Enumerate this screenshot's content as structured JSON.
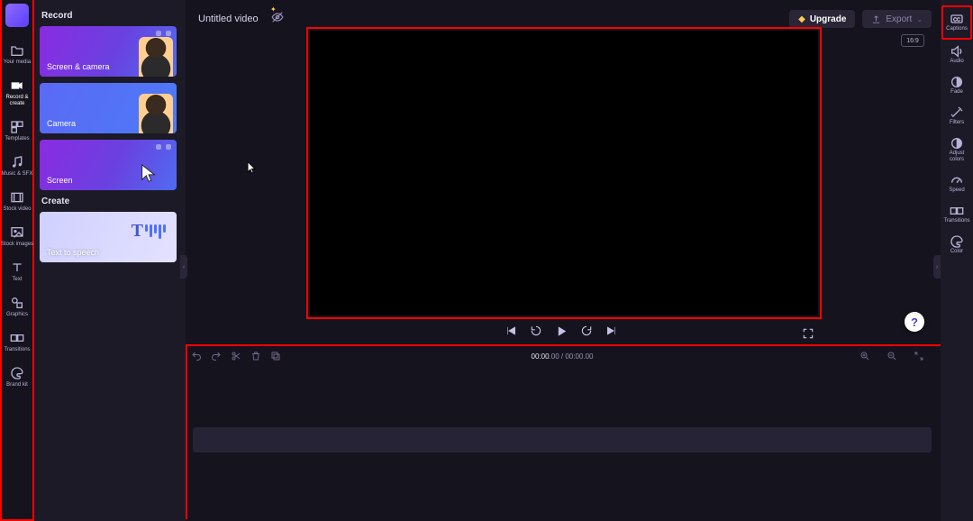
{
  "header": {
    "title": "Untitled video",
    "upgrade_label": "Upgrade",
    "export_label": "Export",
    "aspect_ratio": "16:9"
  },
  "left_rail": [
    {
      "id": "your-media",
      "label": "Your media"
    },
    {
      "id": "record-create",
      "label": "Record & create",
      "active": true
    },
    {
      "id": "templates",
      "label": "Templates"
    },
    {
      "id": "music-sfx",
      "label": "Music & SFX"
    },
    {
      "id": "stock-video",
      "label": "Stock video"
    },
    {
      "id": "stock-images",
      "label": "Stock images"
    },
    {
      "id": "text",
      "label": "Text"
    },
    {
      "id": "graphics",
      "label": "Graphics"
    },
    {
      "id": "transitions",
      "label": "Transitions"
    },
    {
      "id": "brand-kit",
      "label": "Brand kit"
    }
  ],
  "panel": {
    "section_record": "Record",
    "section_create": "Create",
    "cards": {
      "screen_camera": "Screen & camera",
      "camera": "Camera",
      "screen": "Screen",
      "tts": "Text to speech"
    }
  },
  "playback": {
    "current_time": "00:00",
    "current_ms": ".00",
    "total_time": "00:00",
    "total_ms": ".00"
  },
  "right_rail": [
    {
      "id": "captions",
      "label": "Captions"
    },
    {
      "id": "audio",
      "label": "Audio"
    },
    {
      "id": "fade",
      "label": "Fade"
    },
    {
      "id": "filters",
      "label": "Filters"
    },
    {
      "id": "adjust",
      "label": "Adjust colors"
    },
    {
      "id": "speed",
      "label": "Speed"
    },
    {
      "id": "transitions",
      "label": "Transitions"
    },
    {
      "id": "color",
      "label": "Color"
    }
  ],
  "help": "?"
}
